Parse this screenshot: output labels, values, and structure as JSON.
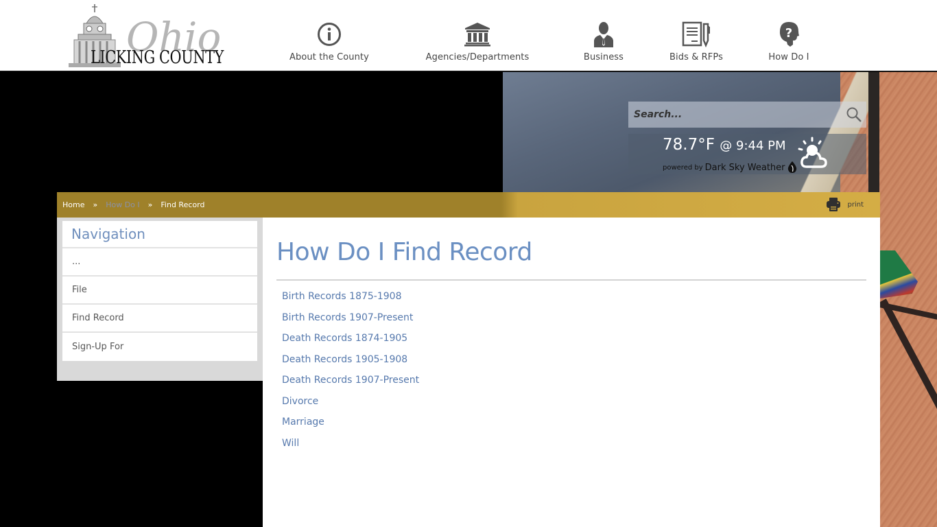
{
  "header": {
    "logo": {
      "script_text": "Ohio",
      "name_text": "Licking County"
    },
    "nav": [
      {
        "label": "About the County",
        "icon": "info-circle-icon"
      },
      {
        "label": "Agencies/Departments",
        "icon": "government-building-icon"
      },
      {
        "label": "Business",
        "icon": "businessman-icon"
      },
      {
        "label": "Bids & RFPs",
        "icon": "document-pen-icon"
      },
      {
        "label": "How Do I",
        "icon": "head-question-icon"
      }
    ]
  },
  "search": {
    "placeholder": "Search...",
    "value": "",
    "icon": "search-icon"
  },
  "weather": {
    "temperature": "78.7°F",
    "time": "@ 9:44 PM",
    "powered_by": "powered by",
    "provider": "Dark Sky Weather",
    "condition_icon": "partly-cloudy-day-icon"
  },
  "breadcrumb": {
    "items": [
      "Home",
      "How Do I",
      "Find Record"
    ],
    "separator": "»"
  },
  "print": {
    "label": "print",
    "icon": "printer-icon"
  },
  "sidebar": {
    "title": "Navigation",
    "items": [
      {
        "label": "..."
      },
      {
        "label": "File"
      },
      {
        "label": "Find Record"
      },
      {
        "label": "Sign-Up For"
      }
    ]
  },
  "main": {
    "title": "How Do I Find Record",
    "links": [
      "Birth Records 1875-1908",
      "Birth Records 1907-Present",
      "Death Records 1874-1905",
      "Death Records 1905-1908",
      "Death Records 1907-Present",
      "Divorce",
      "Marriage",
      "Will"
    ]
  },
  "colors": {
    "accent_blue": "#6a8fc2",
    "link_blue": "#5679ad",
    "breadcrumb_gold": "#9f812a",
    "nav_icon_gray": "#555555"
  }
}
